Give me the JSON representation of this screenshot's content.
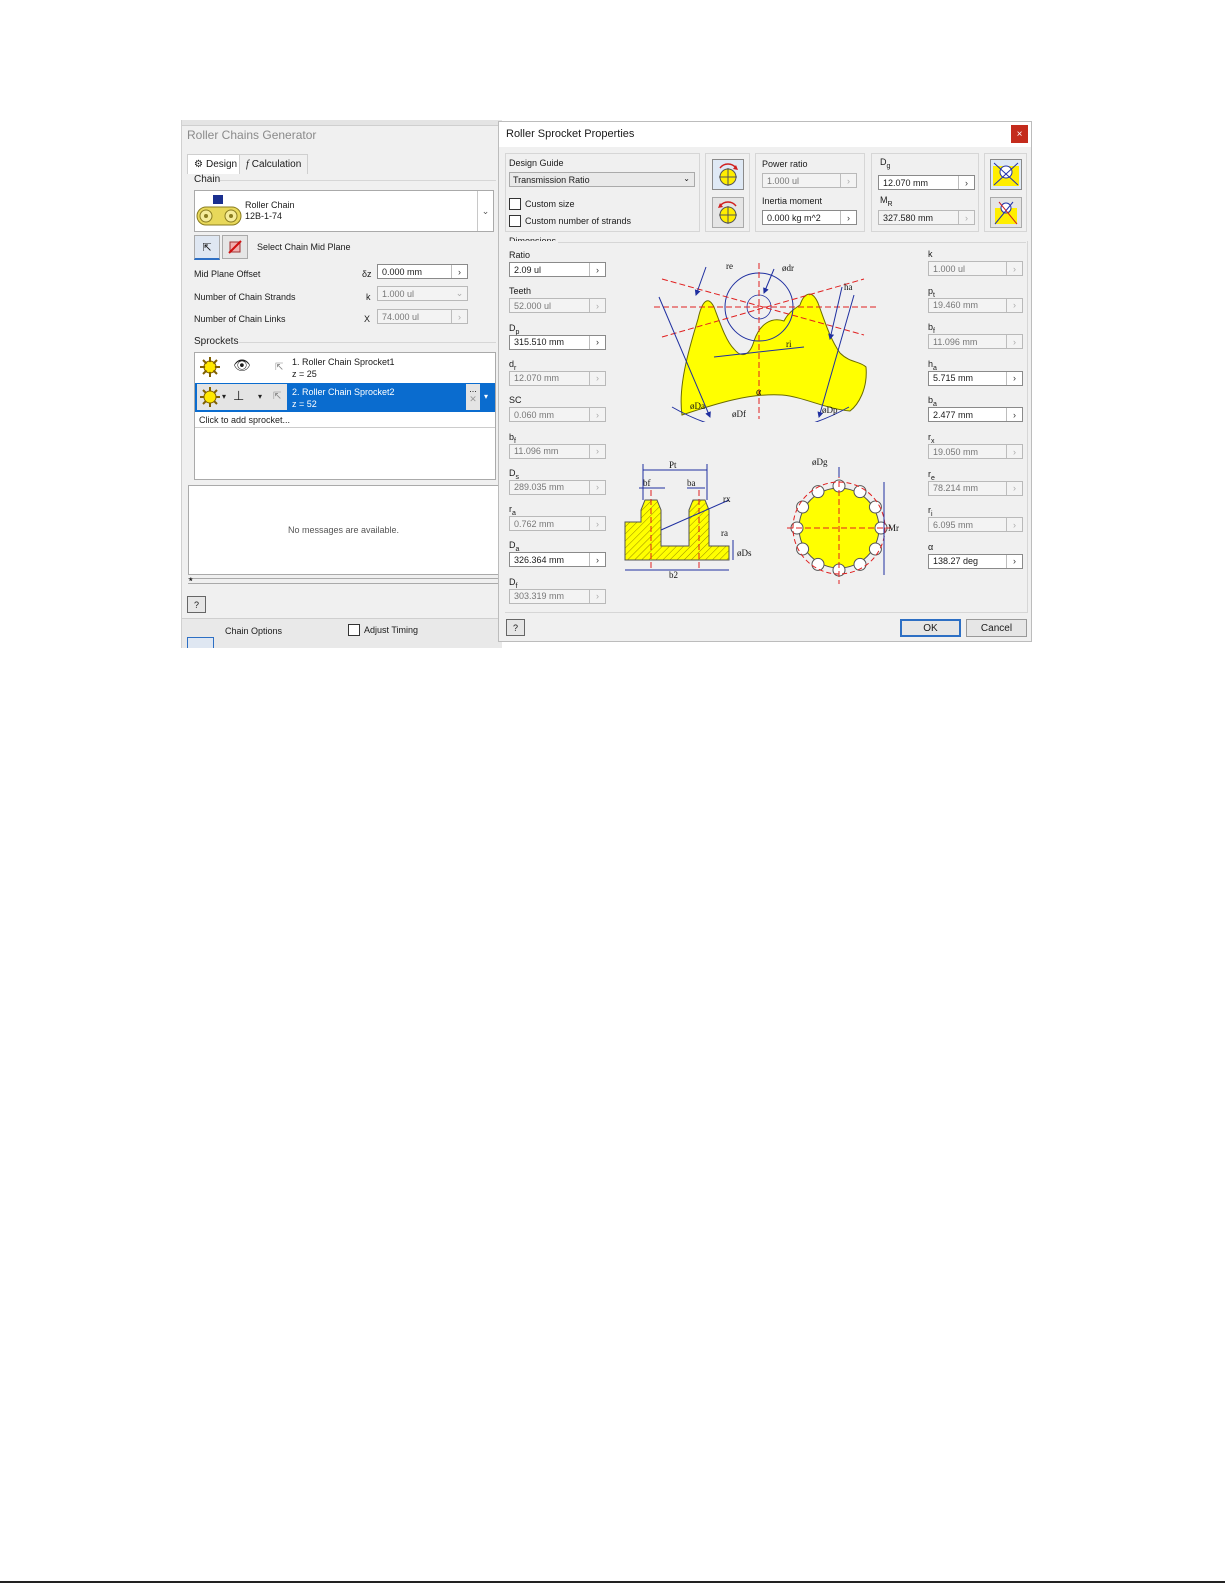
{
  "left_window": {
    "title": "Roller Chains Generator",
    "tabs": [
      {
        "label": "Design",
        "icon": "gear-icon"
      },
      {
        "label": "Calculation",
        "icon": "function-icon"
      }
    ],
    "chain": {
      "group_label": "Chain",
      "name": "Roller Chain",
      "code": "12B-1-74",
      "mid_plane_label": "Select Chain Mid Plane",
      "fields": [
        {
          "label": "Mid Plane Offset",
          "symbol": "δz",
          "value": "0.000 mm"
        },
        {
          "label": "Number of Chain Strands",
          "symbol": "k",
          "value": "1.000 ul"
        },
        {
          "label": "Number of Chain Links",
          "symbol": "X",
          "value": "74.000 ul"
        }
      ]
    },
    "sprockets": {
      "group_label": "Sprockets",
      "items": [
        {
          "name": "1. Roller Chain Sprocket1",
          "teeth": "z = 25"
        },
        {
          "name": "2. Roller Chain Sprocket2",
          "teeth": "z = 52"
        }
      ],
      "add_label": "Click to add sprocket...",
      "more_label": "..."
    },
    "messages": "No messages are available.",
    "splitter_marker": "*",
    "help_label": "?",
    "chain_options_label": "Chain Options",
    "adjust_timing_label": "Adjust Timing"
  },
  "dialog": {
    "title": "Roller Sprocket Properties",
    "close_label": "×",
    "design_guide": {
      "label": "Design Guide",
      "selected": "Transmission Ratio",
      "custom_size": "Custom size",
      "custom_strands": "Custom number of strands"
    },
    "power_ratio": {
      "label": "Power ratio",
      "value": "1.000 ul"
    },
    "inertia_moment": {
      "label": "Inertia moment",
      "value": "0.000 kg m^2"
    },
    "dg": {
      "label": "D",
      "sub": "g",
      "value": "12.070 mm"
    },
    "mr": {
      "label": "M",
      "sub": "R",
      "value": "327.580 mm"
    },
    "dimensions_label": "Dimensions",
    "dims_left": [
      {
        "label": "Ratio",
        "sub": "",
        "value": "2.09 ul",
        "enabled": true
      },
      {
        "label": "Teeth",
        "sub": "",
        "value": "52.000 ul",
        "enabled": false
      },
      {
        "label": "D",
        "sub": "p",
        "value": "315.510 mm",
        "enabled": true
      },
      {
        "label": "d",
        "sub": "r",
        "value": "12.070 mm",
        "enabled": false
      },
      {
        "label": "SC",
        "sub": "",
        "value": "0.060 mm",
        "enabled": false
      },
      {
        "label": "b",
        "sub": "f",
        "value": "11.096 mm",
        "enabled": false
      },
      {
        "label": "D",
        "sub": "s",
        "value": "289.035 mm",
        "enabled": false
      },
      {
        "label": "r",
        "sub": "a",
        "value": "0.762 mm",
        "enabled": false
      },
      {
        "label": "D",
        "sub": "a",
        "value": "326.364 mm",
        "enabled": true
      },
      {
        "label": "D",
        "sub": "f",
        "value": "303.319 mm",
        "enabled": false
      }
    ],
    "dims_right": [
      {
        "label": "k",
        "sub": "",
        "value": "1.000 ul",
        "enabled": false
      },
      {
        "label": "p",
        "sub": "t",
        "value": "19.460 mm",
        "enabled": false
      },
      {
        "label": "b",
        "sub": "f",
        "value": "11.096 mm",
        "enabled": false
      },
      {
        "label": "h",
        "sub": "a",
        "value": "5.715 mm",
        "enabled": true
      },
      {
        "label": "b",
        "sub": "a",
        "value": "2.477 mm",
        "enabled": true
      },
      {
        "label": "r",
        "sub": "x",
        "value": "19.050 mm",
        "enabled": false
      },
      {
        "label": "r",
        "sub": "e",
        "value": "78.214 mm",
        "enabled": false
      },
      {
        "label": "r",
        "sub": "i",
        "value": "6.095 mm",
        "enabled": false
      },
      {
        "label": "α",
        "sub": "",
        "value": "138.27 deg",
        "enabled": true
      }
    ],
    "diagram_labels": {
      "re": "re",
      "dr": "ødr",
      "ha": "ha",
      "ri": "ri",
      "alpha": "α",
      "Da": "øDa",
      "Df": "øDf",
      "Dp": "øDp",
      "pt": "Pt",
      "bf": "bf",
      "ba": "ba",
      "rx": "rx",
      "ra": "ra",
      "Ds": "øDs",
      "b2": "b2",
      "Dg": "øDg",
      "Mr": "Mr"
    },
    "ok_label": "OK",
    "cancel_label": "Cancel",
    "help_label": "?"
  },
  "colors": {
    "selection": "#0a6ccf",
    "sprocket_fill": "#ffff00",
    "dimension_line": "#1f2fa0",
    "center_line": "#e02020",
    "close_button": "#c42b1c"
  }
}
